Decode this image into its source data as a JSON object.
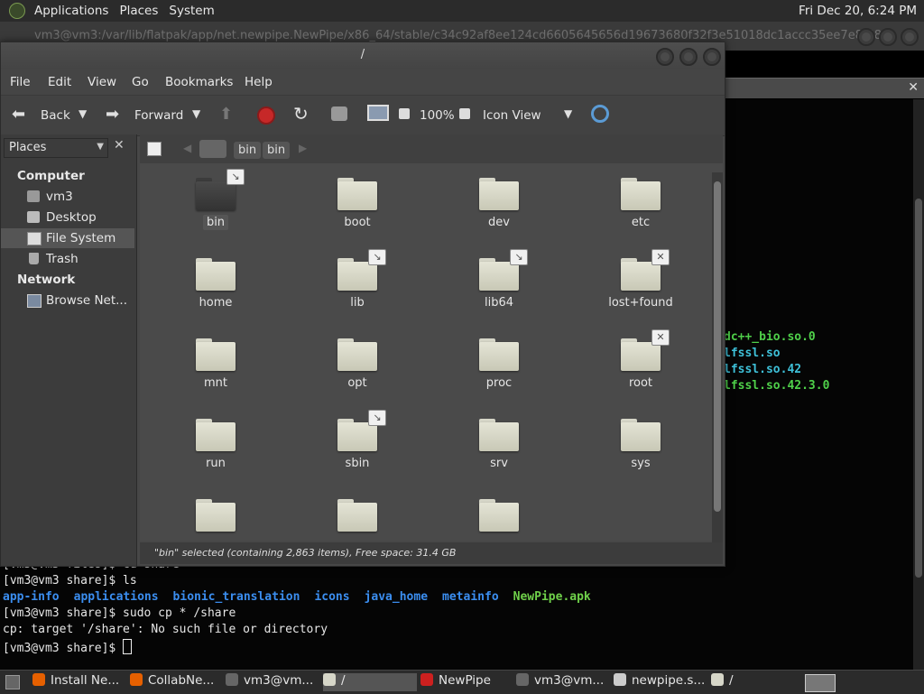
{
  "top_panel": {
    "menus": [
      "Applications",
      "Places",
      "System"
    ],
    "clock": "Fri Dec 20,  6:24 PM"
  },
  "background_window": {
    "title": "vm3@vm3:/var/lib/flatpak/app/net.newpipe.NewPipe/x86_64/stable/c34c92af8ee124cd6605645656d19673680f32f3e51018dc1accc35ee7e8f48..."
  },
  "terminal": {
    "right_lines": [
      "dc++_bio.so.0",
      "lfssl.so",
      "lfssl.so.42",
      "lfssl.so.42.3.0"
    ],
    "line0": "[vm3@vm3 files]$ cd share",
    "prompt1": "[vm3@vm3 share]$ ls",
    "ls_output": [
      {
        "name": "app-info",
        "color": "#3b8ef0"
      },
      {
        "name": "applications",
        "color": "#3b8ef0"
      },
      {
        "name": "bionic_translation",
        "color": "#3b8ef0"
      },
      {
        "name": "icons",
        "color": "#3b8ef0"
      },
      {
        "name": "java_home",
        "color": "#3b8ef0"
      },
      {
        "name": "metainfo",
        "color": "#3b8ef0"
      },
      {
        "name": "NewPipe.apk",
        "color": "#6fd04a"
      }
    ],
    "prompt2": "[vm3@vm3 share]$ sudo cp * /share",
    "error": "cp: target '/share': No such file or directory",
    "prompt3": "[vm3@vm3 share]$ "
  },
  "file_manager": {
    "title": "/",
    "menu": [
      "File",
      "Edit",
      "View",
      "Go",
      "Bookmarks",
      "Help"
    ],
    "toolbar": {
      "back": "Back",
      "forward": "Forward",
      "zoom": "100%",
      "view_mode": "Icon View"
    },
    "sidebar": {
      "combo_label": "Places",
      "sections": [
        {
          "heading": "Computer",
          "items": [
            "vm3",
            "Desktop",
            "File System",
            "Trash"
          ]
        },
        {
          "heading": "Network",
          "items": [
            "Browse Net..."
          ]
        }
      ],
      "selected": "File System"
    },
    "pathbar": [
      "bin",
      "bin"
    ],
    "folders": [
      {
        "name": "bin",
        "emblem": "link",
        "selected": true
      },
      {
        "name": "boot",
        "emblem": ""
      },
      {
        "name": "dev",
        "emblem": ""
      },
      {
        "name": "etc",
        "emblem": ""
      },
      {
        "name": "home",
        "emblem": ""
      },
      {
        "name": "lib",
        "emblem": "link"
      },
      {
        "name": "lib64",
        "emblem": "link"
      },
      {
        "name": "lost+found",
        "emblem": "noaccess"
      },
      {
        "name": "mnt",
        "emblem": ""
      },
      {
        "name": "opt",
        "emblem": ""
      },
      {
        "name": "proc",
        "emblem": ""
      },
      {
        "name": "root",
        "emblem": "noaccess"
      },
      {
        "name": "run",
        "emblem": ""
      },
      {
        "name": "sbin",
        "emblem": "link"
      },
      {
        "name": "srv",
        "emblem": ""
      },
      {
        "name": "sys",
        "emblem": ""
      },
      {
        "name": "",
        "emblem": ""
      },
      {
        "name": "",
        "emblem": ""
      },
      {
        "name": "",
        "emblem": ""
      }
    ],
    "status": "\"bin\" selected (containing 2,863 items), Free space: 31.4 GB"
  },
  "taskbar": [
    {
      "label": "Install Ne...",
      "icon": "firefox-icon",
      "color": "#e66000"
    },
    {
      "label": "CollabNe...",
      "icon": "firefox-icon",
      "color": "#e66000"
    },
    {
      "label": "vm3@vm...",
      "icon": "terminal-icon",
      "color": "#666666"
    },
    {
      "label": "/",
      "icon": "folder-icon",
      "color": "#d6d6c8",
      "active": true
    },
    {
      "label": "NewPipe",
      "icon": "newpipe-icon",
      "color": "#cd201f"
    },
    {
      "label": "vm3@vm...",
      "icon": "terminal-icon",
      "color": "#666666"
    },
    {
      "label": "newpipe.s...",
      "icon": "text-editor-icon",
      "color": "#cccccc"
    },
    {
      "label": "/",
      "icon": "folder-icon",
      "color": "#d6d6c8"
    }
  ]
}
